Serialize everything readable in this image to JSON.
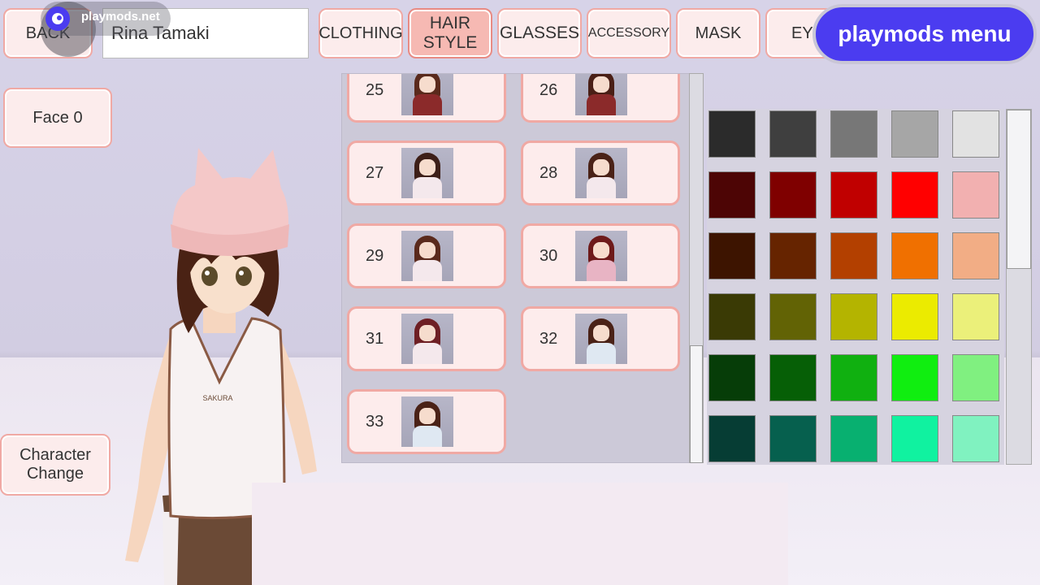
{
  "top_bar": {
    "back_label": "BACK",
    "name_value": "Rina Tamaki",
    "tabs": [
      {
        "label": "CLOTHING",
        "active": false
      },
      {
        "label": "HAIR\nSTYLE",
        "active": true
      },
      {
        "label": "GLASSES",
        "active": false
      },
      {
        "label": "ACCESSORY",
        "active": false
      },
      {
        "label": "MASK",
        "active": false
      },
      {
        "label": "EYE",
        "active": false
      }
    ]
  },
  "overlay": {
    "site_label": "playmods.net",
    "menu_label": "playmods menu",
    "brand_color": "#4b3cf0"
  },
  "side_buttons": {
    "face_label": "Face 0",
    "character_change_label": "Character\nChange"
  },
  "hair_styles": [
    {
      "number": "25",
      "hair_color": "#5a2a1c",
      "outfit_color": "#8b2a2a"
    },
    {
      "number": "26",
      "hair_color": "#4a1f16",
      "outfit_color": "#8b2a2a"
    },
    {
      "number": "27",
      "hair_color": "#3d1f18",
      "outfit_color": "#f4e8ec"
    },
    {
      "number": "28",
      "hair_color": "#4a2217",
      "outfit_color": "#f4e8ec"
    },
    {
      "number": "29",
      "hair_color": "#5a2a1c",
      "outfit_color": "#f4e8ec"
    },
    {
      "number": "30",
      "hair_color": "#6e1a1a",
      "outfit_color": "#e8b4c4"
    },
    {
      "number": "31",
      "hair_color": "#6e1f24",
      "outfit_color": "#f4e8ec"
    },
    {
      "number": "32",
      "hair_color": "#4a2217",
      "outfit_color": "#dfe8f2"
    },
    {
      "number": "33",
      "hair_color": "#4a2217",
      "outfit_color": "#dfe8f2"
    }
  ],
  "color_palette": [
    [
      "#2b2b2b",
      "#3f3f3f",
      "#777777",
      "#a6a6a6",
      "#e2e2e2"
    ],
    [
      "#4d0505",
      "#7f0000",
      "#c00000",
      "#ff0000",
      "#f2b0b0"
    ],
    [
      "#3d1400",
      "#662400",
      "#b34000",
      "#f07000",
      "#f2ad85"
    ],
    [
      "#3a3a05",
      "#626305",
      "#b4b400",
      "#ebeb00",
      "#ebf07a"
    ],
    [
      "#063d08",
      "#065f06",
      "#10b010",
      "#10ee10",
      "#80f080"
    ],
    [
      "#063d34",
      "#06604e",
      "#08b070",
      "#10f2a0",
      "#80f2c0"
    ]
  ],
  "character": {
    "shirt_logo": "SAKURA"
  }
}
